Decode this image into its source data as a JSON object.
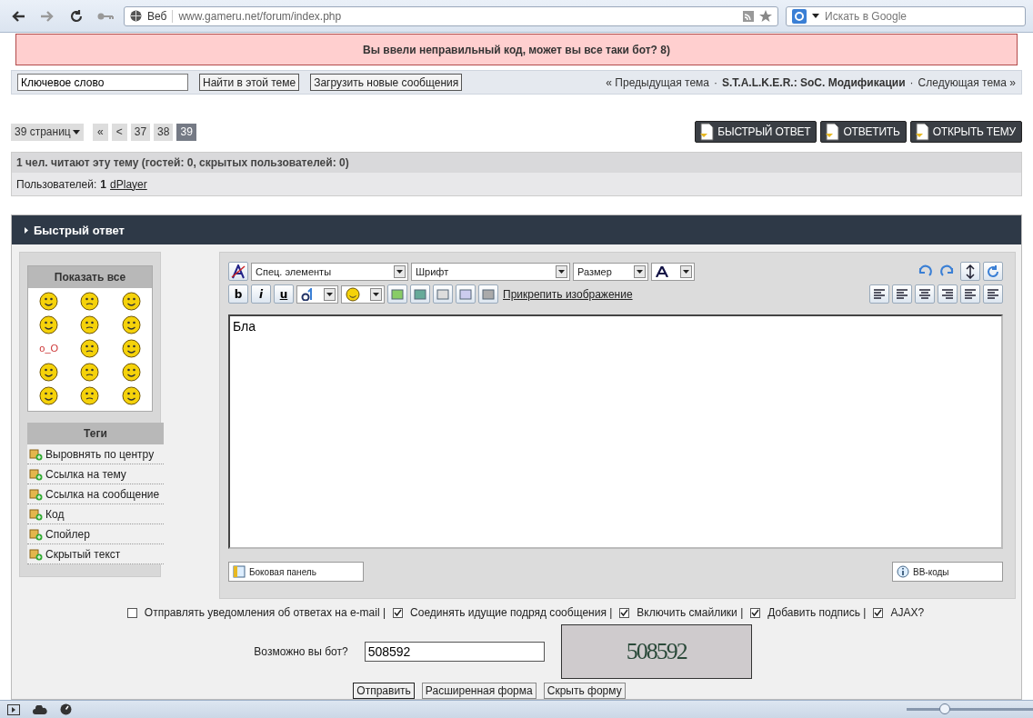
{
  "browser": {
    "scheme_label": "Веб",
    "url": "www.gameru.net/forum/index.php",
    "search_placeholder": "Искать в Google"
  },
  "error": {
    "text": "Вы ввели неправильный код, может вы все таки бот? 8)"
  },
  "search": {
    "value": "Ключевое слово",
    "buttons": [
      "Найти в этой теме",
      "Загрузить новые сообщения"
    ]
  },
  "topic_nav": {
    "separator": "·",
    "items": [
      {
        "kind": "link",
        "label": "« Предыдущая тема"
      },
      {
        "kind": "title",
        "label": "S.T.A.L.K.E.R.: SoC. Модификации"
      },
      {
        "kind": "link",
        "label": "Следующая тема »"
      }
    ]
  },
  "pagination": {
    "pages_label": "39 страниц",
    "items": [
      {
        "label": "«",
        "selected": false
      },
      {
        "label": "<",
        "selected": false
      },
      {
        "label": "37",
        "selected": false
      },
      {
        "label": "38",
        "selected": false
      },
      {
        "label": "39",
        "selected": true
      }
    ]
  },
  "actions": [
    "БЫСТРЫЙ ОТВЕТ",
    "ОТВЕТИТЬ",
    "ОТКРЫТЬ ТЕМУ"
  ],
  "online": {
    "title": "1 чел. читают эту тему (гостей: 0, скрытых пользователей: 0)",
    "users_label": "Пользователей:",
    "users_count": "1",
    "users": [
      "dPlayer"
    ]
  },
  "quick_reply": {
    "title": "Быстрый ответ",
    "smilies": {
      "title": "Показать все",
      "items": [
        {
          "kind": "smiley"
        },
        {
          "kind": "smiley"
        },
        {
          "kind": "smiley"
        },
        {
          "kind": "smiley"
        },
        {
          "kind": "smiley"
        },
        {
          "kind": "smiley"
        },
        {
          "kind": "text",
          "label": "o_O"
        },
        {
          "kind": "smiley"
        },
        {
          "kind": "smiley"
        },
        {
          "kind": "smiley"
        },
        {
          "kind": "smiley"
        },
        {
          "kind": "smiley"
        },
        {
          "kind": "smiley"
        },
        {
          "kind": "smiley"
        },
        {
          "kind": "smiley"
        }
      ]
    },
    "tags": {
      "title": "Теги",
      "items": [
        "Выровнять по центру",
        "Ссылка на тему",
        "Ссылка на сообщение",
        "Код",
        "Спойлер",
        "Скрытый текст"
      ]
    },
    "editor": {
      "selects": [
        "Спец. элементы",
        "Шрифт",
        "Размер"
      ],
      "format_buttons": [
        "b",
        "i",
        "u"
      ],
      "attach_link": "Прикрепить изображение",
      "content": "Бла",
      "side_panel": "Боковая панель",
      "bbcodes": "BB-коды"
    },
    "options": [
      {
        "label": "Отправлять уведомления об ответах на e-mail |",
        "checked": false
      },
      {
        "label": "Соединять идущие подряд сообщения |",
        "checked": true
      },
      {
        "label": "Включить смайлики |",
        "checked": true
      },
      {
        "label": "Добавить подпись |",
        "checked": true
      },
      {
        "label": "AJAX?",
        "checked": true
      }
    ],
    "captcha": {
      "label": "Возможно вы бот?",
      "value": "508592",
      "image_text": "508592"
    },
    "buttons": [
      "Отправить",
      "Расширенная форма",
      "Скрыть форму"
    ]
  },
  "status_bar": {
    "zoom": {
      "level": 0.3
    }
  }
}
